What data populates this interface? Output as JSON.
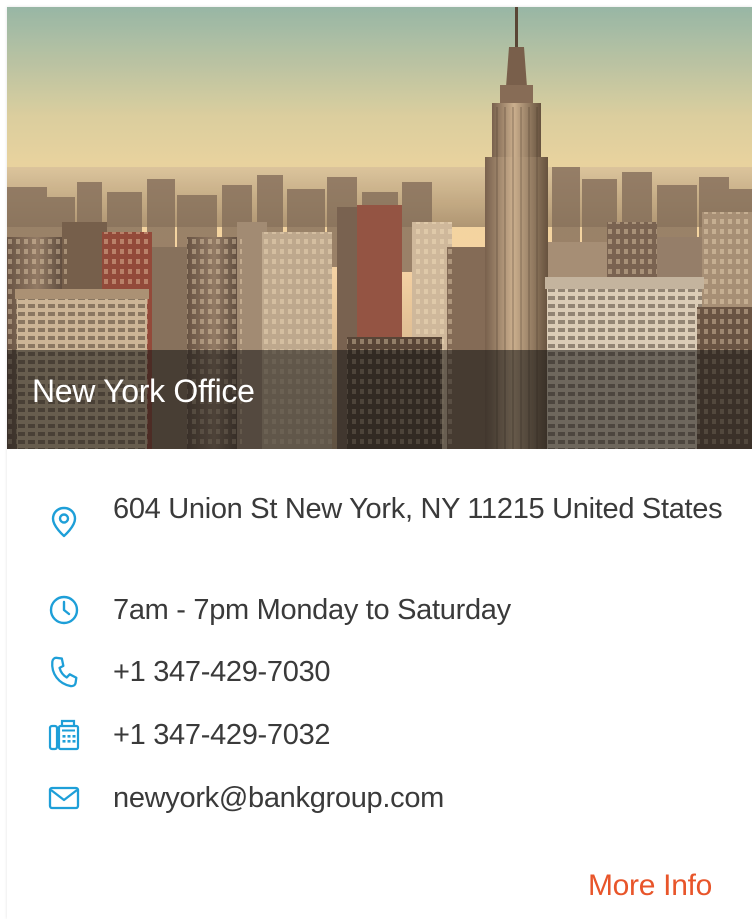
{
  "office": {
    "title": "New York Office",
    "hero_image": "new-york-skyline-photo"
  },
  "details": {
    "address": "604 Union St New York, NY 11215 United States",
    "hours": "7am - 7pm Monday to Saturday",
    "phone": "+1 347-429-7030",
    "fax": "+1 347-429-7032",
    "email": "newyork@bankgroup.com"
  },
  "icons": {
    "address": "location-pin-icon",
    "hours": "clock-icon",
    "phone": "phone-icon",
    "fax": "fax-icon",
    "email": "envelope-icon"
  },
  "actions": {
    "more_info": "More Info"
  },
  "colors": {
    "icon": "#1e9fd8",
    "accent": "#e8552a",
    "text": "#3a3a3a",
    "title_band": "rgba(20,20,20,0.55)"
  }
}
